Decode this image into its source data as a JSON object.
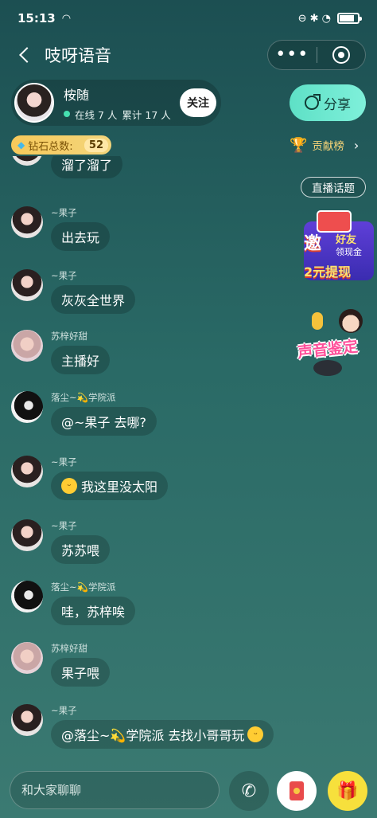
{
  "status_bar": {
    "time": "15:13",
    "wifi": "◠",
    "icons": "⊖ ✱ ◔"
  },
  "nav": {
    "title": "吱呀语音",
    "more_label": "•••"
  },
  "host": {
    "name": "桉随",
    "online": "在线 7 人",
    "total": "累计 17 人",
    "follow_label": "关注"
  },
  "share": {
    "label": "分享"
  },
  "diamond": {
    "label": "钻石总数:",
    "count": "52"
  },
  "contrib": {
    "label": "贡献榜",
    "chevron": "›"
  },
  "topic_button": "直播话题",
  "promo_invite": {
    "l1": "邀",
    "l2": "好友",
    "l3": "领现金",
    "l4": "2元提现"
  },
  "promo_voice": {
    "text": "声音鉴定"
  },
  "messages": [
    {
      "name": "",
      "text": "溜了溜了",
      "avatar": "guozi"
    },
    {
      "name": "~果子",
      "text": "出去玩",
      "avatar": "guozi"
    },
    {
      "name": "~果子",
      "text": "灰灰全世界",
      "avatar": "guozi"
    },
    {
      "name": "苏梓好甜",
      "text": "主播好",
      "avatar": "suzi"
    },
    {
      "name": "落尘~💫学院派",
      "text": "@~果子 去哪?",
      "avatar": "luochen"
    },
    {
      "name": "~果子",
      "text": "我这里没太阳",
      "avatar": "guozi",
      "emoji": "laugh"
    },
    {
      "name": "~果子",
      "text": "苏苏喂",
      "avatar": "guozi"
    },
    {
      "name": "落尘~💫学院派",
      "text": "哇，苏梓唉",
      "avatar": "luochen"
    },
    {
      "name": "苏梓好甜",
      "text": "果子喂",
      "avatar": "suzi"
    },
    {
      "name": "~果子",
      "text": "@落尘~💫学院派 去找小哥哥玩",
      "avatar": "guozi",
      "emoji_after": "smirk"
    }
  ],
  "input": {
    "placeholder": "和大家聊聊"
  },
  "colors": {
    "accent_share": "#6ee8d0",
    "diamond_bg": "#f5cf6a",
    "gift_bg": "#f7e03c"
  }
}
